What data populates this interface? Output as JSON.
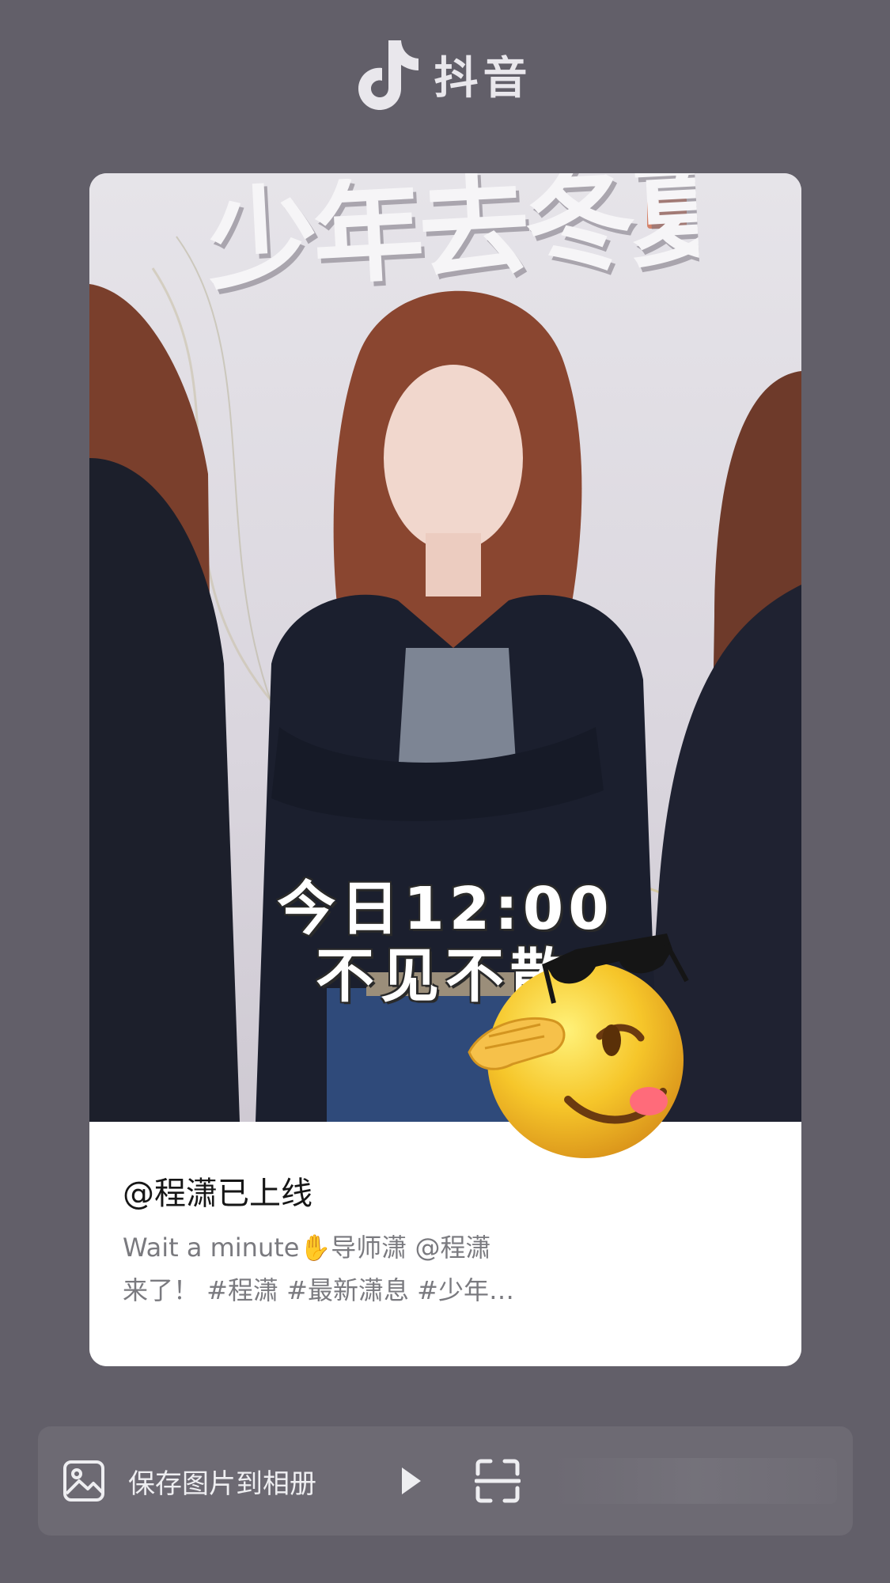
{
  "header": {
    "app_name": "抖音",
    "logo_icon": "douyin-note-icon"
  },
  "post": {
    "poster_title": "少年去冬夏",
    "caption_line1": "今日12:00",
    "caption_line2": "不见不散",
    "username": "@程潇已上线",
    "description_line1": "Wait a minute✋导师潇 @程潇",
    "description_line2": "来了！ #程潇  #最新潇息 #少年…",
    "sticker_icon": "sunglasses-salute-emoji"
  },
  "action_bar": {
    "save_label": "保存图片到相册",
    "save_icon": "image-icon",
    "play_icon": "play-triangle-icon",
    "scan_icon": "scan-icon"
  },
  "colors": {
    "background": "#625f69",
    "action_bar": "#6d6a73",
    "card": "#ffffff",
    "username": "#161616",
    "description": "#7a7a7f"
  }
}
